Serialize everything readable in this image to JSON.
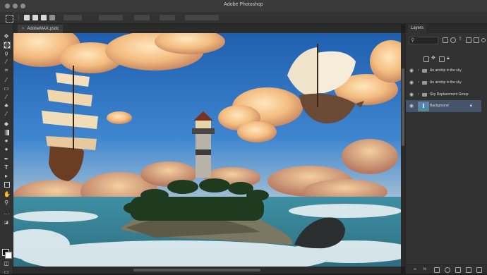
{
  "window": {
    "title": "Adobe Photoshop"
  },
  "document": {
    "tab_label": "AdobeMAX.psdc",
    "close_glyph": "×"
  },
  "panel": {
    "tab_label": "Layers",
    "search_icon": "search-icon",
    "layers": [
      {
        "name": "An airship in the sky",
        "kind": "group",
        "visible": true
      },
      {
        "name": "An airship in the sky",
        "kind": "group",
        "visible": true
      },
      {
        "name": "Sky Replacement Group",
        "kind": "group",
        "visible": true
      },
      {
        "name": "Background",
        "kind": "image",
        "visible": true,
        "locked": true,
        "selected": true
      }
    ],
    "footer_buttons": [
      "link-icon",
      "fx-icon",
      "mask-icon",
      "adjustment-icon",
      "folder-icon",
      "new-layer-icon",
      "trash-icon"
    ],
    "footer_fx": "fx"
  },
  "tools": [
    "move-icon",
    "marquee-icon",
    "lasso-icon",
    "magic-wand-icon",
    "crop-icon",
    "eyedropper-icon",
    "healing-icon",
    "brush-icon",
    "clone-stamp-icon",
    "history-brush-icon",
    "eraser-icon",
    "gradient-icon",
    "blur-icon",
    "dodge-icon",
    "pen-icon",
    "type-icon",
    "path-select-icon",
    "shape-icon",
    "hand-icon",
    "zoom-icon",
    "more-icon"
  ],
  "colors": {
    "selection": "#45536b",
    "chrome": "#323232"
  }
}
